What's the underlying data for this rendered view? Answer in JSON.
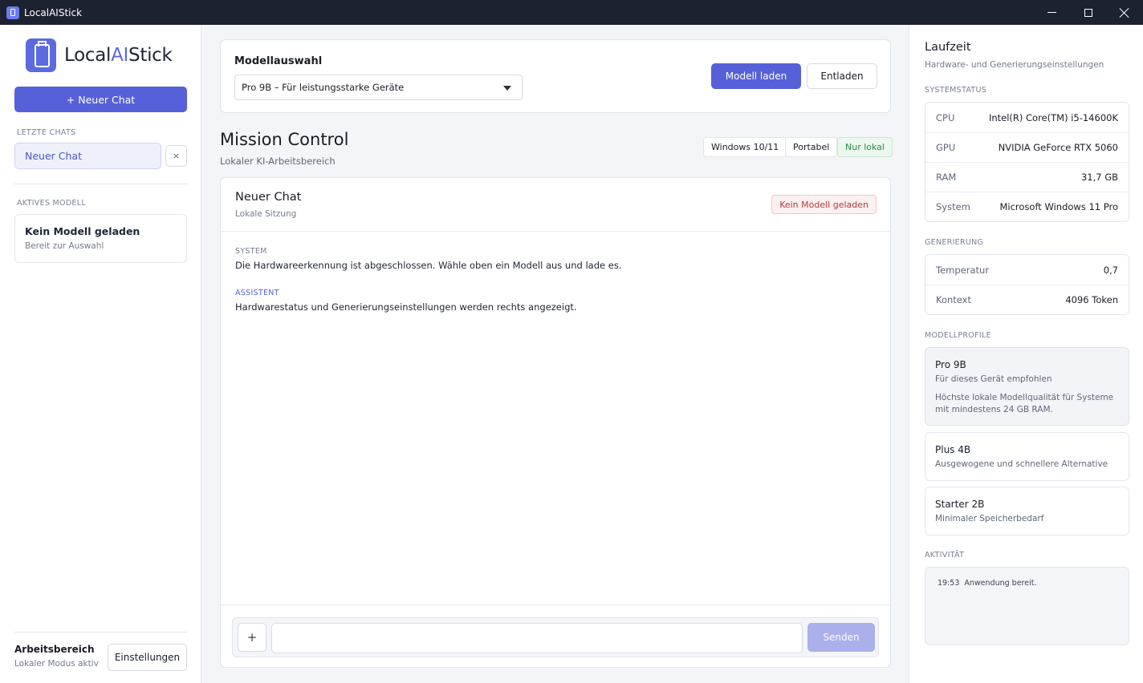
{
  "window": {
    "title": "LocalAIStick"
  },
  "brand": {
    "prefix": "Local",
    "mid": "AI",
    "suffix": "Stick"
  },
  "sidebar": {
    "new_chat_label": "+ Neuer Chat",
    "recent_label": "LETZTE CHATS",
    "chats": [
      {
        "label": "Neuer Chat"
      }
    ],
    "delete_label": "×",
    "active_model_label": "AKTIVES MODELL",
    "active_model": {
      "title": "Kein Modell geladen",
      "subtitle": "Bereit zur Auswahl"
    },
    "workspace": {
      "title": "Arbeitsbereich",
      "subtitle": "Lokaler Modus aktiv"
    },
    "settings_label": "Einstellungen"
  },
  "model_select": {
    "label": "Modellauswahl",
    "selected": "Pro 9B – Für leistungsstarke Geräte",
    "load_label": "Modell laden",
    "unload_label": "Entladen"
  },
  "header": {
    "title": "Mission Control",
    "subtitle": "Lokaler KI-Arbeitsbereich",
    "tags": [
      "Windows 10/11",
      "Portabel",
      "Nur lokal"
    ]
  },
  "chat": {
    "title": "Neuer Chat",
    "subtitle": "Lokale Sitzung",
    "status_badge": "Kein Modell geladen",
    "messages": [
      {
        "role": "SYSTEM",
        "text": "Die Hardwareerkennung ist abgeschlossen. Wähle oben ein Modell aus und lade es."
      },
      {
        "role": "ASSISTENT",
        "text": "Hardwarestatus und Generierungseinstellungen werden rechts angezeigt."
      }
    ],
    "input_value": "",
    "attach_label": "+",
    "send_label": "Senden"
  },
  "runtime": {
    "title": "Laufzeit",
    "subtitle": "Hardware- und Generierungseinstellungen",
    "system_label": "SYSTEMSTATUS",
    "system": [
      {
        "key": "CPU",
        "value": "Intel(R) Core(TM) i5-14600K"
      },
      {
        "key": "GPU",
        "value": "NVIDIA GeForce RTX 5060"
      },
      {
        "key": "RAM",
        "value": "31,7 GB"
      },
      {
        "key": "System",
        "value": "Microsoft Windows 11 Pro"
      }
    ],
    "generation_label": "GENERIERUNG",
    "generation": [
      {
        "key": "Temperatur",
        "value": "0,7"
      },
      {
        "key": "Kontext",
        "value": "4096 Token"
      }
    ],
    "profiles_label": "MODELLPROFILE",
    "profiles": [
      {
        "title": "Pro 9B",
        "subtitle": "Für dieses Gerät empfohlen",
        "description": "Höchste lokale Modellqualität für Systeme mit mindestens 24 GB RAM."
      },
      {
        "title": "Plus 4B",
        "subtitle": "Ausgewogene und schnellere Alternative"
      },
      {
        "title": "Starter 2B",
        "subtitle": "Minimaler Speicherbedarf"
      }
    ],
    "activity_label": "AKTIVITÄT",
    "activity": [
      {
        "time": "19:53",
        "text": "Anwendung bereit."
      }
    ]
  },
  "colors": {
    "accent": "#5661d9",
    "success": "#2a8a45",
    "danger": "#b23a3a"
  }
}
